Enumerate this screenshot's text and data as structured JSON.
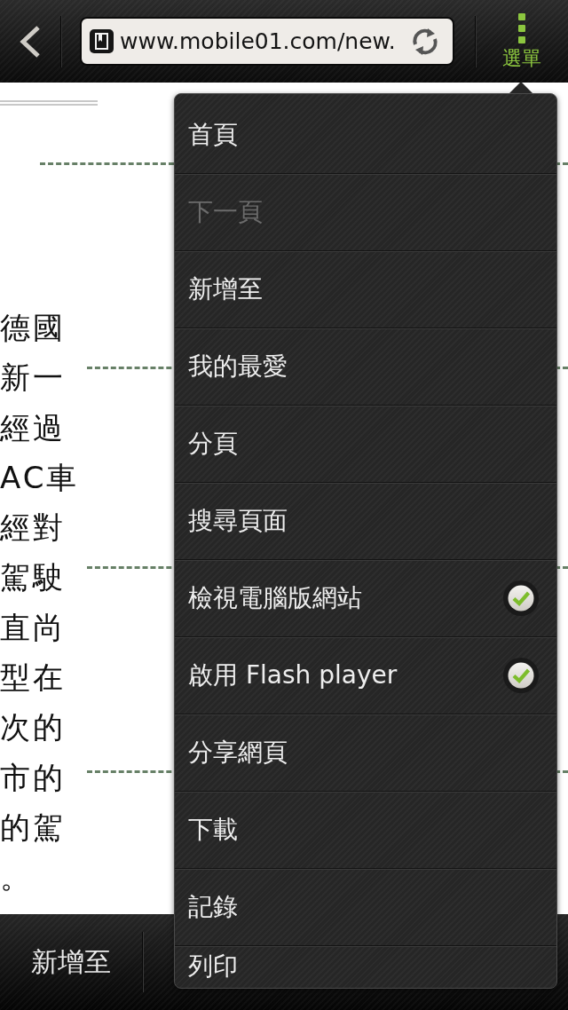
{
  "toolbar": {
    "url": "www.mobile01.com/new.",
    "menu_label": "選單"
  },
  "article": {
    "lines": [
      "德國",
      "新一",
      "經過",
      "AC車",
      "經對",
      "駕駛",
      "直尚",
      "型在",
      "次的",
      "市的",
      "的駕",
      "。"
    ]
  },
  "menu": {
    "items": [
      {
        "label": "首頁",
        "disabled": false,
        "checked": false
      },
      {
        "label": "下一頁",
        "disabled": true,
        "checked": false
      },
      {
        "label": "新增至",
        "disabled": false,
        "checked": false
      },
      {
        "label": "我的最愛",
        "disabled": false,
        "checked": false
      },
      {
        "label": "分頁",
        "disabled": false,
        "checked": false
      },
      {
        "label": "搜尋頁面",
        "disabled": false,
        "checked": false
      },
      {
        "label": "檢視電腦版網站",
        "disabled": false,
        "checked": true
      },
      {
        "label": "啟用 Flash player",
        "disabled": false,
        "checked": true
      },
      {
        "label": "分享網頁",
        "disabled": false,
        "checked": false
      },
      {
        "label": "下載",
        "disabled": false,
        "checked": false
      },
      {
        "label": "記錄",
        "disabled": false,
        "checked": false
      },
      {
        "label": "列印",
        "disabled": false,
        "checked": false
      }
    ]
  },
  "bottom_bar": {
    "items": [
      {
        "label": "新增至"
      }
    ]
  }
}
